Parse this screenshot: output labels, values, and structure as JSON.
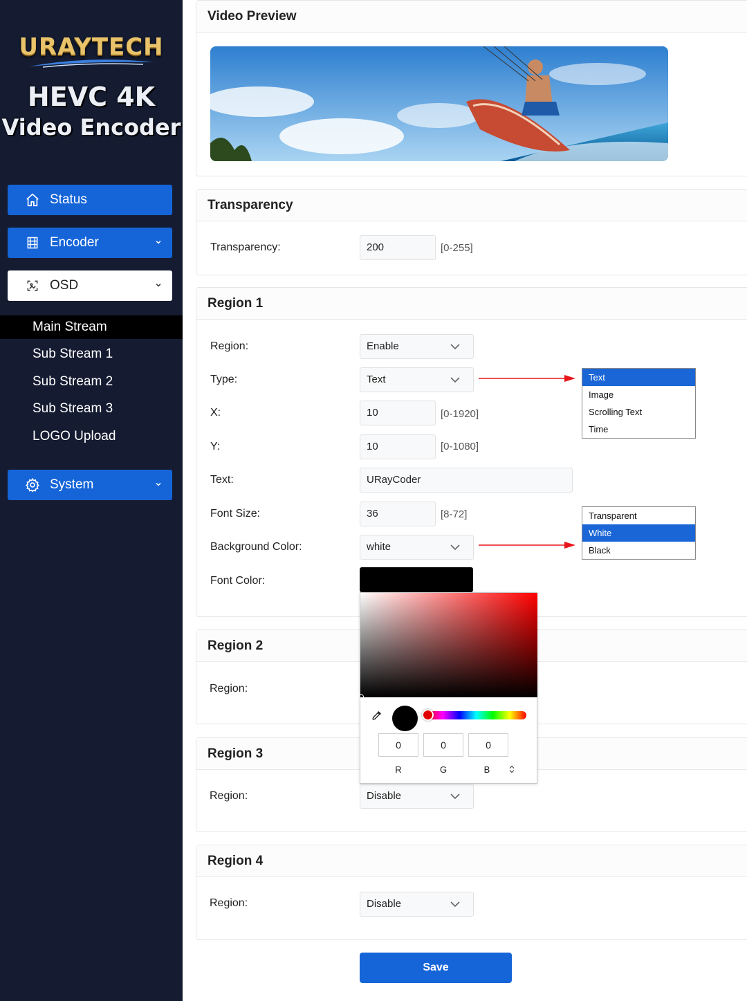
{
  "brand": {
    "logo": "URAYTECH",
    "line1": "HEVC 4K",
    "line2": "Video Encoder"
  },
  "sidebar": {
    "items": [
      {
        "label": "Status",
        "icon": "home-icon"
      },
      {
        "label": "Encoder",
        "icon": "film-icon"
      },
      {
        "label": "OSD",
        "icon": "image-frame-icon"
      },
      {
        "label": "System",
        "icon": "gear-icon"
      }
    ],
    "osd_sub": [
      "Main Stream",
      "Sub Stream 1",
      "Sub Stream 2",
      "Sub Stream 3",
      "LOGO Upload"
    ]
  },
  "preview": {
    "title": "Video Preview"
  },
  "transparency": {
    "title": "Transparency",
    "label": "Transparency:",
    "value": "200",
    "hint": "[0-255]"
  },
  "region1": {
    "title": "Region 1",
    "region_label": "Region:",
    "region_value": "Enable",
    "type_label": "Type:",
    "type_value": "Text",
    "x_label": "X:",
    "x_value": "10",
    "x_hint": "[0-1920]",
    "y_label": "Y:",
    "y_value": "10",
    "y_hint": "[0-1080]",
    "text_label": "Text:",
    "text_value": "URayCoder",
    "fontsize_label": "Font Size:",
    "fontsize_value": "36",
    "fontsize_hint": "[8-72]",
    "bg_label": "Background Color:",
    "bg_value": "white",
    "fontcolor_label": "Font Color:"
  },
  "type_options": [
    "Text",
    "Image",
    "Scrolling Text",
    "Time"
  ],
  "bg_options": [
    "Transparent",
    "White",
    "Black"
  ],
  "color_picker": {
    "r": "0",
    "g": "0",
    "b": "0",
    "r_label": "R",
    "g_label": "G",
    "b_label": "B",
    "current_color": "#000000"
  },
  "region2": {
    "title": "Region 2",
    "region_label": "Region:"
  },
  "region3": {
    "title": "Region 3",
    "region_label": "Region:",
    "region_value": "Disable"
  },
  "region4": {
    "title": "Region 4",
    "region_label": "Region:",
    "region_value": "Disable"
  },
  "save_label": "Save",
  "colors": {
    "accent": "#1565d8",
    "sidebar": "#151c32",
    "arrow": "#e8141a"
  }
}
